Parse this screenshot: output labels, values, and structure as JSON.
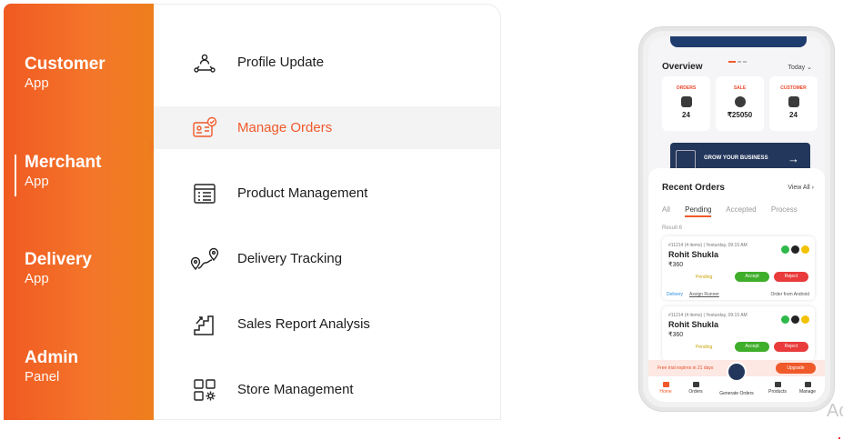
{
  "switcher": {
    "items": [
      {
        "title": "Customer",
        "sub": "App"
      },
      {
        "title": "Merchant",
        "sub": "App"
      },
      {
        "title": "Delivery",
        "sub": "App"
      },
      {
        "title": "Admin",
        "sub": "Panel"
      }
    ],
    "active_index": 1
  },
  "menu": {
    "items": [
      {
        "label": "Profile Update",
        "icon": "profile-network-icon"
      },
      {
        "label": "Manage Orders",
        "icon": "id-card-check-icon"
      },
      {
        "label": "Product Management",
        "icon": "list-document-icon"
      },
      {
        "label": "Delivery Tracking",
        "icon": "route-pin-icon"
      },
      {
        "label": "Sales Report Analysis",
        "icon": "stairs-growth-icon"
      },
      {
        "label": "Store Management",
        "icon": "grid-gear-icon"
      }
    ],
    "active_index": 1
  },
  "phone": {
    "overview_title": "Overview",
    "today": "Today",
    "stats": [
      {
        "label": "ORDERS",
        "value": "24"
      },
      {
        "label": "SALE",
        "value": "₹25050"
      },
      {
        "label": "CUSTOMER",
        "value": "24"
      }
    ],
    "grow_label": "GROW YOUR BUSINESS",
    "recent_title": "Recent Orders",
    "view_all": "View All",
    "tabs": [
      "All",
      "Pending",
      "Accepted",
      "Process"
    ],
    "result": "Result 6",
    "orders": [
      {
        "meta": "#11214 (4 items) | Yesturday, 09:15 AM",
        "name": "Rohit Shukla",
        "amount": "₹360",
        "status": "Pending",
        "accept": "Accept",
        "reject": "Reject",
        "delivery": "Delivery",
        "assign": "Assign Runner",
        "order_from": "Order from Android"
      },
      {
        "meta": "#11214 (4 items) | Yesturday, 09:15 AM",
        "name": "Rohit Shukla",
        "amount": "₹360",
        "status": "Pending",
        "accept": "Accept",
        "reject": "Reject"
      }
    ],
    "trial_text": "Free trial expires in 21 days",
    "upgrade": "Upgrade",
    "nav": [
      "Home",
      "Orders",
      "Generate Orders",
      "Products",
      "Manage"
    ]
  },
  "edge_text": "Ac",
  "colors": {
    "accent": "#f0592a",
    "navy": "#23365b"
  }
}
